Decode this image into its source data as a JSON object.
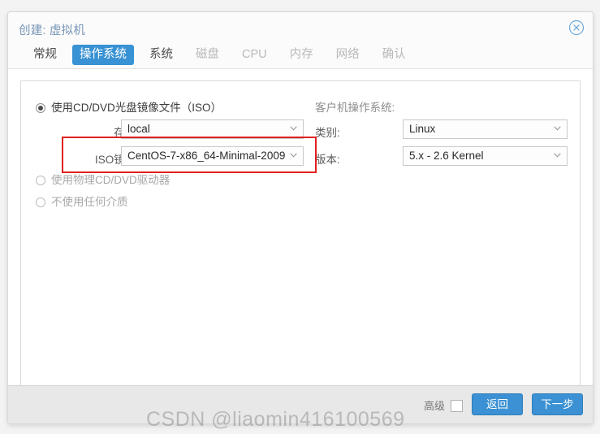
{
  "window": {
    "title": "创建: 虚拟机",
    "close_icon": "close-circle-icon"
  },
  "tabs": [
    {
      "label": "常规",
      "state": "enabled"
    },
    {
      "label": "操作系统",
      "state": "active"
    },
    {
      "label": "系统",
      "state": "enabled"
    },
    {
      "label": "磁盘",
      "state": "disabled"
    },
    {
      "label": "CPU",
      "state": "disabled"
    },
    {
      "label": "内存",
      "state": "disabled"
    },
    {
      "label": "网络",
      "state": "disabled"
    },
    {
      "label": "确认",
      "state": "disabled"
    }
  ],
  "left_column": {
    "radio_iso": "使用CD/DVD光盘镜像文件（ISO）",
    "radio_physical": "使用物理CD/DVD驱动器",
    "radio_none": "不使用任何介质",
    "storage_label": "存储:",
    "storage_value": "local",
    "iso_label": "ISO镜像:",
    "iso_value": "CentOS-7-x86_64-Minimal-2009"
  },
  "right_column": {
    "guest_os_label": "客户机操作系统:",
    "type_label": "类别:",
    "type_value": "Linux",
    "version_label": "版本:",
    "version_value": "5.x - 2.6 Kernel"
  },
  "footer": {
    "advanced_label": "高级",
    "back_label": "返回",
    "next_label": "下一步"
  },
  "watermark": {
    "text": "CSDN @liaomin416100569"
  },
  "colors": {
    "accent": "#3892d4",
    "button": "#3b91d3",
    "title": "#7896b8",
    "highlight_box": "#e02020",
    "footer_bg": "#e8e8e8"
  }
}
